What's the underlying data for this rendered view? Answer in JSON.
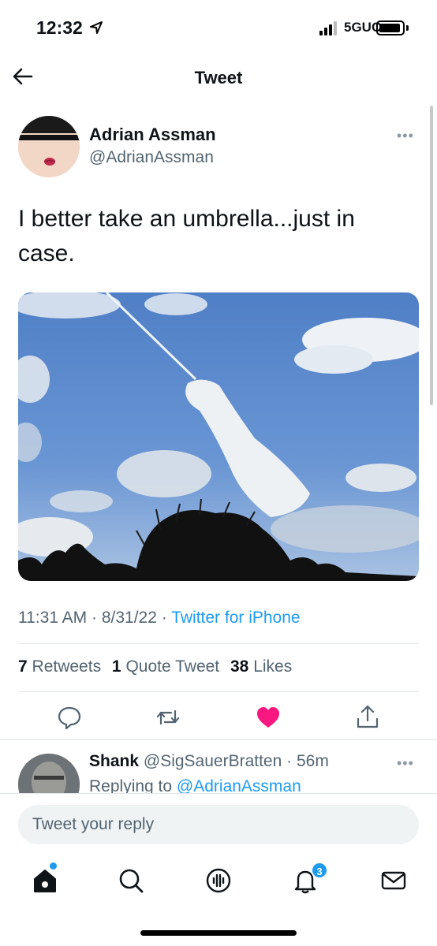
{
  "status_bar": {
    "time": "12:32",
    "network": "5GUC",
    "icons": [
      "location-arrow-icon",
      "signal-icon",
      "battery-icon"
    ]
  },
  "header": {
    "title": "Tweet",
    "back_icon": "back-arrow-icon"
  },
  "tweet": {
    "author_name": "Adrian Assman",
    "author_handle": "@AdrianAssman",
    "text": "I better take an umbrella...just in case.",
    "timestamp": "11:31 AM · 8/31/22 · ",
    "source": "Twitter for iPhone",
    "stats": {
      "retweets_count": "7",
      "retweets_label": "Retweets",
      "quotes_count": "1",
      "quotes_label": "Quote Tweet",
      "likes_count": "38",
      "likes_label": "Likes"
    },
    "actions": [
      "reply-icon",
      "retweet-icon",
      "like-icon",
      "share-icon"
    ],
    "liked": true,
    "like_color": "#f91880"
  },
  "reply": {
    "name": "Shank",
    "handle": "@SigSauerBratten",
    "time": "· 56m",
    "replying_label": "Replying to",
    "replying_to": "@AdrianAssman"
  },
  "composer": {
    "placeholder": "Tweet your reply"
  },
  "tabbar": {
    "items": [
      "home-icon",
      "search-icon",
      "spaces-icon",
      "notifications-icon",
      "messages-icon"
    ],
    "notification_count": "3"
  },
  "colors": {
    "accent": "#1d9bf0",
    "text": "#0f1419",
    "secondary": "#536471"
  }
}
